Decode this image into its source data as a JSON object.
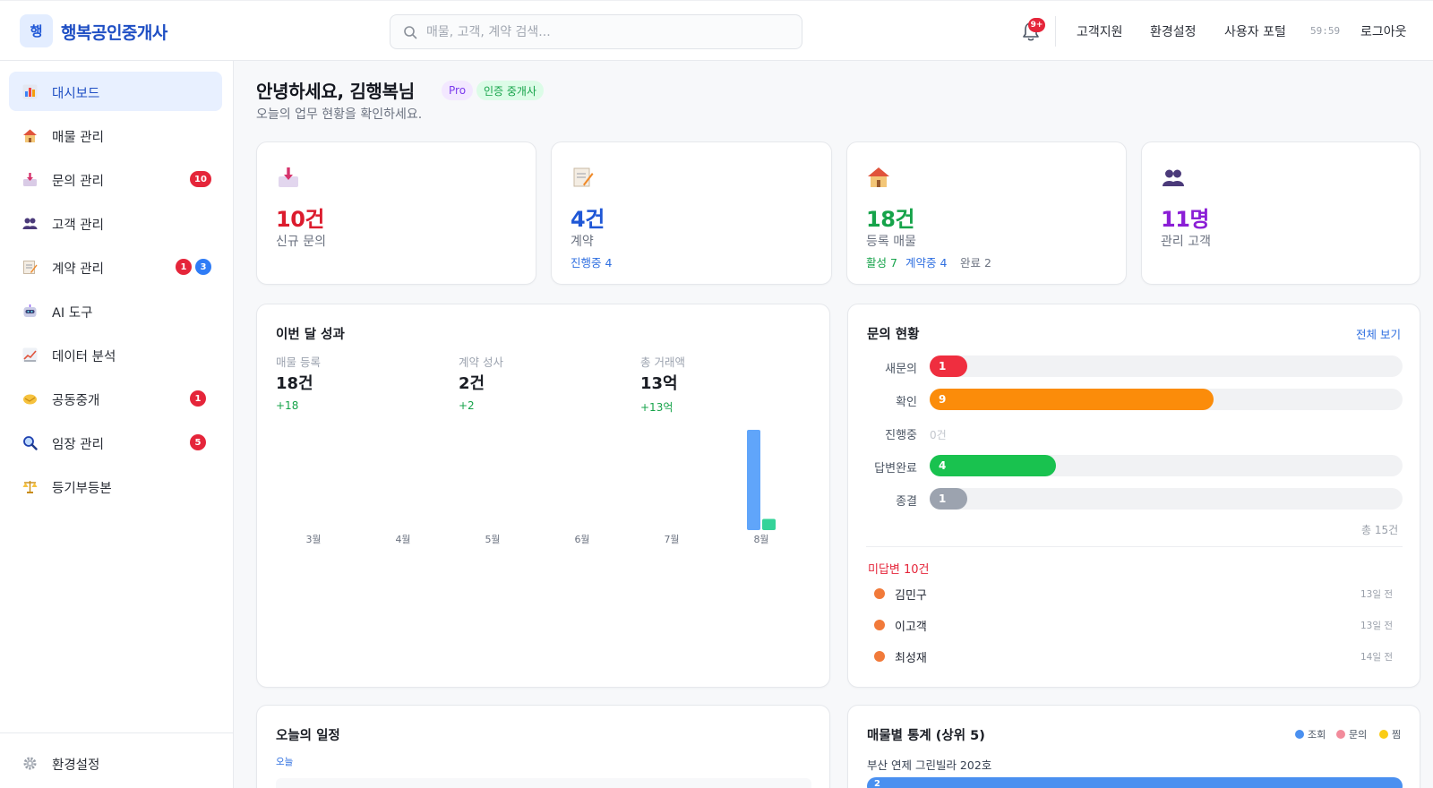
{
  "header": {
    "logo_char": "행",
    "brand": "행복공인중개사",
    "search_placeholder": "매물, 고객, 계약 검색...",
    "bell_badge": "9+",
    "links": [
      "고객지원",
      "환경설정",
      "사용자 포털"
    ],
    "clock": "59:59",
    "logout": "로그아웃"
  },
  "sidebar": {
    "items": [
      {
        "label": "대시보드",
        "icon": "bar-chart-icon"
      },
      {
        "label": "매물 관리",
        "icon": "house-icon"
      },
      {
        "label": "문의 관리",
        "icon": "inbox-icon",
        "badge": "10"
      },
      {
        "label": "고객 관리",
        "icon": "users-icon"
      },
      {
        "label": "계약 관리",
        "icon": "memo-icon",
        "badge": "1",
        "badge2": "3"
      },
      {
        "label": "AI 도구",
        "icon": "robot-icon"
      },
      {
        "label": "데이터 분석",
        "icon": "trend-chart-icon"
      },
      {
        "label": "공동중개",
        "icon": "handshake-icon",
        "badge": "1"
      },
      {
        "label": "임장 관리",
        "icon": "magnifier-icon",
        "badge": "5"
      },
      {
        "label": "등기부등본",
        "icon": "scales-icon"
      }
    ],
    "settings": "환경설정"
  },
  "greeting": {
    "title": "안녕하세요, 김행복님",
    "tag_pro": "Pro",
    "tag_cert": "인증 중개사",
    "subtitle": "오늘의 업무 현황을 확인하세요."
  },
  "stats": [
    {
      "value": "10건",
      "label": "신규 문의",
      "color": "#dc1c2e",
      "icon": "inbox-icon"
    },
    {
      "value": "4건",
      "label": "계약",
      "sub": "진행중 4",
      "color": "#1f57d6",
      "icon": "memo-icon"
    },
    {
      "value": "18건",
      "label": "등록 매물",
      "sub_active": "활성 7",
      "sub_contract": "계약중 4",
      "sub_done": "완료 2",
      "color": "#16a34a",
      "icon": "house-icon"
    },
    {
      "value": "11명",
      "label": "관리 고객",
      "color": "#8b1fd6",
      "icon": "users-icon"
    }
  ],
  "performance": {
    "title": "이번 달 성과",
    "kpis": [
      {
        "label": "매물 등록",
        "value": "18건",
        "delta": "+18"
      },
      {
        "label": "계약 성사",
        "value": "2건",
        "delta": "+2"
      },
      {
        "label": "총 거래액",
        "value": "13억",
        "delta": "+13억"
      }
    ]
  },
  "chart_data": {
    "type": "bar",
    "categories": [
      "3월",
      "4월",
      "5월",
      "6월",
      "7월",
      "8월"
    ],
    "series": [
      {
        "values": [
          0,
          0,
          0,
          0,
          0,
          18
        ],
        "color": "#60a5fa"
      },
      {
        "values": [
          0,
          0,
          0,
          0,
          0,
          2
        ],
        "color": "#34d399"
      }
    ],
    "ylim": [
      0,
      18
    ]
  },
  "inquiries": {
    "title": "문의 현황",
    "view_all": "전체 보기",
    "rows": [
      {
        "label": "새문의",
        "count": 1,
        "color": "#ef2e3f"
      },
      {
        "label": "확인",
        "count": 9,
        "color": "#fb8c0a"
      },
      {
        "label": "진행중",
        "count": 0,
        "zero_text": "0건"
      },
      {
        "label": "답변완료",
        "count": 4,
        "color": "#19c24f"
      },
      {
        "label": "종결",
        "count": 1,
        "color": "#9ca3af"
      }
    ],
    "max": 15,
    "total": "총 15건",
    "pending_title": "미답변 10건",
    "pending": [
      {
        "name": "김민구",
        "ago": "13일 전"
      },
      {
        "name": "이고객",
        "ago": "13일 전"
      },
      {
        "name": "최성재",
        "ago": "14일 전"
      }
    ]
  },
  "schedule": {
    "title": "오늘의 일정",
    "today": "오늘"
  },
  "property_stats": {
    "title": "매물별 통계 (상위 5)",
    "legend": [
      {
        "label": "조회",
        "color": "#4a90f0"
      },
      {
        "label": "문의",
        "color": "#f28b9b"
      },
      {
        "label": "찜",
        "color": "#facc15"
      }
    ],
    "first_name": "부산 연제 그린빌라 202호",
    "first_value": "2"
  }
}
